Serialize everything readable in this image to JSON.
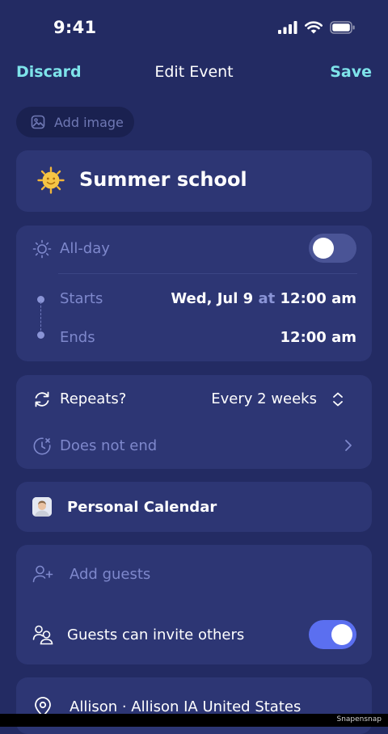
{
  "status_bar": {
    "time": "9:41"
  },
  "nav": {
    "discard": "Discard",
    "title": "Edit Event",
    "save": "Save"
  },
  "add_image": {
    "label": "Add image"
  },
  "event": {
    "emoji": "🌞",
    "title": "Summer school"
  },
  "time": {
    "all_day_label": "All-day",
    "all_day_on": false,
    "starts_label": "Starts",
    "starts_date": "Wed, Jul 9",
    "at_label": "at",
    "starts_time": "12:00 am",
    "ends_label": "Ends",
    "ends_time": "12:00 am"
  },
  "repeat": {
    "label": "Repeats?",
    "value": "Every 2 weeks",
    "end_label": "Does not end"
  },
  "calendar": {
    "name": "Personal Calendar"
  },
  "guests": {
    "add_label": "Add guests",
    "invite_label": "Guests can invite others",
    "invite_on": true
  },
  "location": {
    "text": "Allison · Allison IA United States"
  },
  "footer": {
    "brand": "Snapensnap"
  },
  "colors": {
    "background": "#232b63",
    "card": "#2d3674",
    "accent": "#7ee3ea",
    "toggle_on": "#5b6ff0"
  }
}
